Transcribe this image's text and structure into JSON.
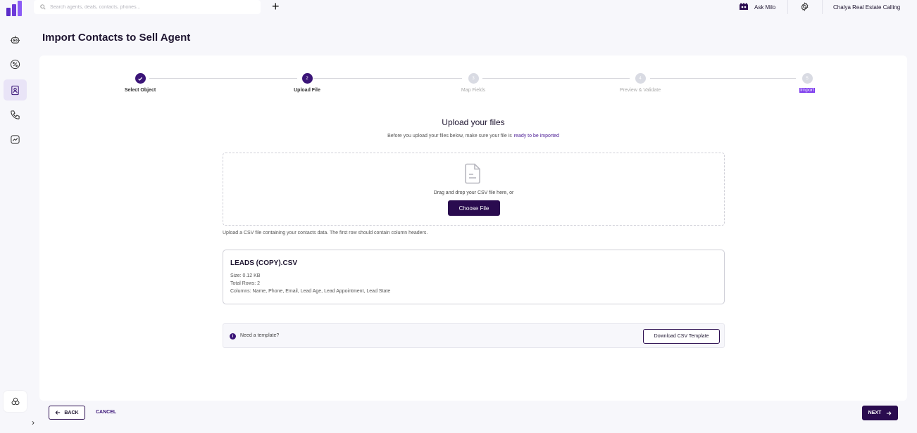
{
  "search": {
    "placeholder": "Search agents, deals, contacts, phones..."
  },
  "header": {
    "ask_milo": "Ask Milo",
    "company": "Chalya Real Estate Calling"
  },
  "page": {
    "title": "Import Contacts to Sell Agent"
  },
  "sidebar": {
    "items": [
      {
        "icon": "robot-icon"
      },
      {
        "icon": "percent-badge-icon"
      },
      {
        "icon": "contacts-book-icon",
        "active": true
      },
      {
        "icon": "phone-icon"
      },
      {
        "icon": "chart-icon"
      }
    ],
    "bottom_icon": "integrations-icon"
  },
  "stepper": {
    "steps": [
      {
        "label": "Select Object",
        "number": "1",
        "state": "done"
      },
      {
        "label": "Upload File",
        "number": "2",
        "state": "current"
      },
      {
        "label": "Map Fields",
        "number": "3",
        "state": "pending"
      },
      {
        "label": "Preview & Validate",
        "number": "4",
        "state": "pending"
      },
      {
        "label": "Import",
        "number": "5",
        "state": "pending"
      }
    ]
  },
  "upload": {
    "title": "Upload your files",
    "subtitle": "Before you upload your files below, make sure your file is",
    "subtitle_accent": "ready to be imported",
    "drop_text": "Drag and drop your CSV file here, or",
    "choose_label": "Choose File",
    "hint": "Upload a CSV file containing your contacts data. The first row should contain column headers."
  },
  "file": {
    "name": "LEADS (COPY).CSV",
    "size": "Size: 0.12 KB",
    "rows": "Total Rows: 2",
    "columns": "Columns: Name, Phone, Email, Lead Age, Lead Appointment, Lead State"
  },
  "template": {
    "text": "Need a template?",
    "button": "Download CSV Template"
  },
  "footer": {
    "back": "BACK",
    "cancel": "CANCEL",
    "next": "NEXT"
  },
  "colors": {
    "primary": "#2a0b4f",
    "accent": "#3b1578",
    "highlight": "#7c3aed"
  }
}
